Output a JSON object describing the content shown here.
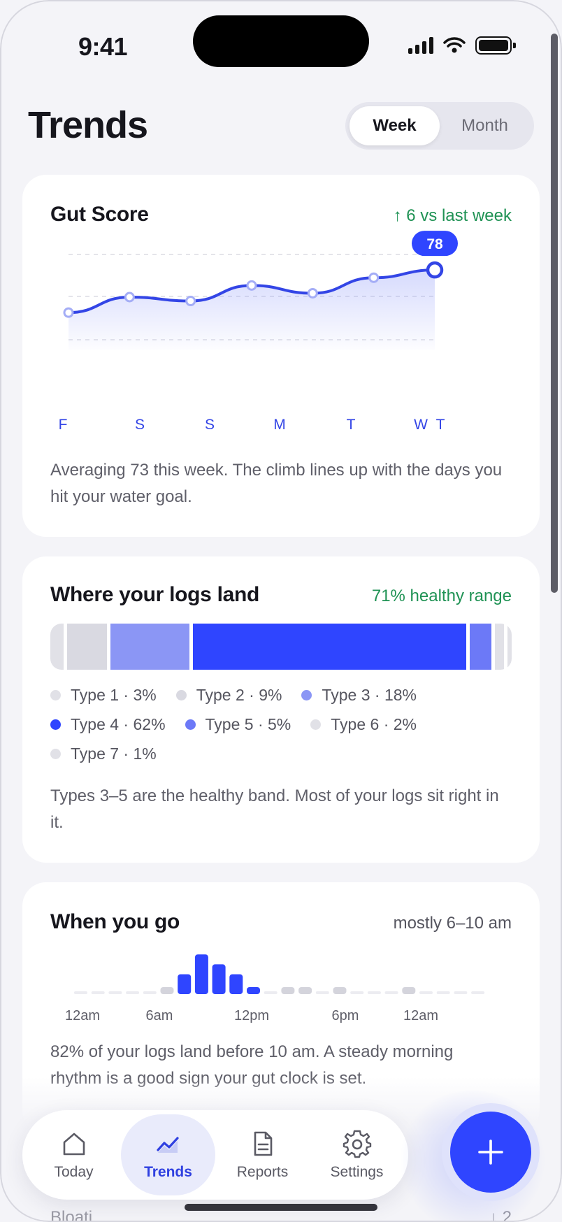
{
  "status": {
    "time": "9:41"
  },
  "header": {
    "title": "Trends",
    "segments": [
      "Week",
      "Month"
    ],
    "selected_segment": "Week"
  },
  "gut_score": {
    "title": "Gut Score",
    "delta": "↑ 6 vs last week",
    "days": [
      "F",
      "S",
      "S",
      "M",
      "T",
      "W",
      "T"
    ],
    "latest_label": "78",
    "summary": "Averaging 73 this week. The climb lines up with the days you hit your water goal."
  },
  "logs": {
    "title": "Where your logs land",
    "meta": "71% healthy range",
    "legend": [
      {
        "label": "Type 1 · 3%",
        "color": "#e1e1e7"
      },
      {
        "label": "Type 2 · 9%",
        "color": "#d9d9e1"
      },
      {
        "label": "Type 3 · 18%",
        "color": "#8b96f5"
      },
      {
        "label": "Type 4 · 62%",
        "color": "#2f45ff"
      },
      {
        "label": "Type 5 · 5%",
        "color": "#6c79f7"
      },
      {
        "label": "Type 6 · 2%",
        "color": "#e1e1e7"
      },
      {
        "label": "Type 7 · 1%",
        "color": "#e1e1e7"
      }
    ],
    "summary": "Types 3–5 are the healthy band. Most of your logs sit right in it."
  },
  "timing": {
    "title": "When you go",
    "meta": "mostly 6–10 am",
    "hour_labels": [
      "12am",
      "6am",
      "12pm",
      "6pm",
      "12am"
    ],
    "summary_line1": "82% of your logs land before 10 am. A steady morning",
    "summary_line2": "rhythm is a good sign your gut clock is set."
  },
  "peek": {
    "left": "Bloati",
    "right": "↓ 2"
  },
  "tabs": [
    {
      "label": "Today",
      "icon": "home-icon"
    },
    {
      "label": "Trends",
      "icon": "trend-icon"
    },
    {
      "label": "Reports",
      "icon": "document-icon"
    },
    {
      "label": "Settings",
      "icon": "gear-icon"
    }
  ],
  "active_tab": "Trends",
  "colors": {
    "accent": "#2f45ff",
    "positive": "#1f9254"
  },
  "chart_data": [
    {
      "type": "area",
      "title": "Gut Score",
      "categories": [
        "F",
        "S",
        "S",
        "M",
        "T",
        "W",
        "T"
      ],
      "values": [
        67,
        71,
        70,
        74,
        72,
        76,
        78
      ],
      "ylim": [
        60,
        82
      ]
    },
    {
      "type": "bar",
      "title": "Where your logs land",
      "categories": [
        "Type 1",
        "Type 2",
        "Type 3",
        "Type 4",
        "Type 5",
        "Type 6",
        "Type 7"
      ],
      "values": [
        3,
        9,
        18,
        62,
        5,
        2,
        1
      ]
    },
    {
      "type": "bar",
      "title": "When you go",
      "values": [
        0,
        0,
        0,
        0,
        0,
        1,
        4,
        8,
        6,
        4,
        1,
        0,
        1,
        1,
        0,
        1,
        0,
        0,
        0,
        1,
        0,
        0,
        0,
        0
      ]
    }
  ]
}
